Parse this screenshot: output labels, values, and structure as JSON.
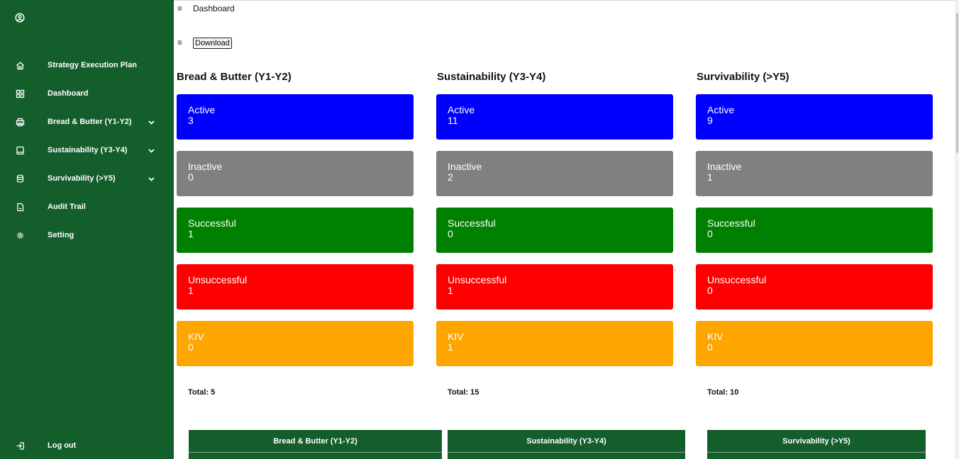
{
  "sidebar": {
    "items": [
      {
        "label": "Strategy Execution Plan",
        "icon": "home-icon"
      },
      {
        "label": "Dashboard",
        "icon": "grid-icon"
      },
      {
        "label": "Bread & Butter (Y1-Y2)",
        "icon": "print-icon",
        "expandable": true
      },
      {
        "label": "Sustainability (Y3-Y4)",
        "icon": "book-icon",
        "expandable": true
      },
      {
        "label": "Survivability (>Y5)",
        "icon": "database-icon",
        "expandable": true
      },
      {
        "label": "Audit Trail",
        "icon": "file-icon"
      },
      {
        "label": "Setting",
        "icon": "gear-icon"
      }
    ],
    "logout_label": "Log out",
    "color": "#145e2c"
  },
  "header": {
    "title": "Dashboard",
    "download_label": "Download"
  },
  "columns": [
    {
      "title": "Bread & Butter (Y1-Y2)",
      "cards": [
        {
          "label": "Active",
          "value": "3"
        },
        {
          "label": "Inactive",
          "value": "0"
        },
        {
          "label": "Successful",
          "value": "1"
        },
        {
          "label": "Unsuccessful",
          "value": "1"
        },
        {
          "label": "KIV",
          "value": "0"
        }
      ],
      "total": "Total: 5",
      "table_header": "Bread & Butter (Y1-Y2)"
    },
    {
      "title": "Sustainability (Y3-Y4)",
      "cards": [
        {
          "label": "Active",
          "value": "11"
        },
        {
          "label": "Inactive",
          "value": "2"
        },
        {
          "label": "Successful",
          "value": "0"
        },
        {
          "label": "Unsuccessful",
          "value": "1"
        },
        {
          "label": "KIV",
          "value": "1"
        }
      ],
      "total": "Total: 15",
      "table_header": "Sustainability (Y3-Y4)"
    },
    {
      "title": "Survivability (>Y5)",
      "cards": [
        {
          "label": "Active",
          "value": "9"
        },
        {
          "label": "Inactive",
          "value": "1"
        },
        {
          "label": "Successful",
          "value": "0"
        },
        {
          "label": "Unsuccessful",
          "value": "0"
        },
        {
          "label": "KIV",
          "value": "0"
        }
      ],
      "total": "Total: 10",
      "table_header": "Survivability (>Y5)"
    }
  ],
  "status_colors": {
    "Active": "#0000ff",
    "Inactive": "#808080",
    "Successful": "#008000",
    "Unsuccessful": "#ff0000",
    "KIV": "#ffa500"
  }
}
